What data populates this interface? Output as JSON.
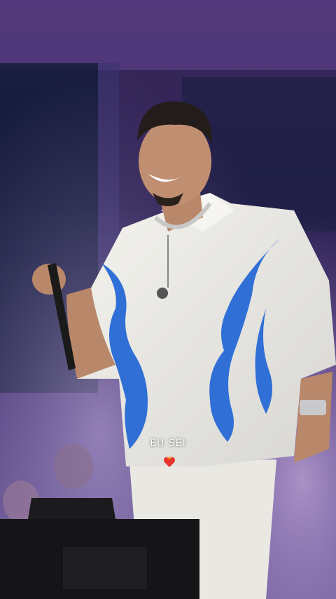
{
  "overlay": {
    "lyric_text": "EU SEI",
    "lyric_emoji": "heart-on-fire-icon"
  },
  "colors": {
    "stage_purple": "#5b3b8f",
    "haze": "#b9a6d8",
    "shirt": "#ecebe3",
    "flame_blue": "#2f6fd6",
    "heart": "#e8332c"
  }
}
